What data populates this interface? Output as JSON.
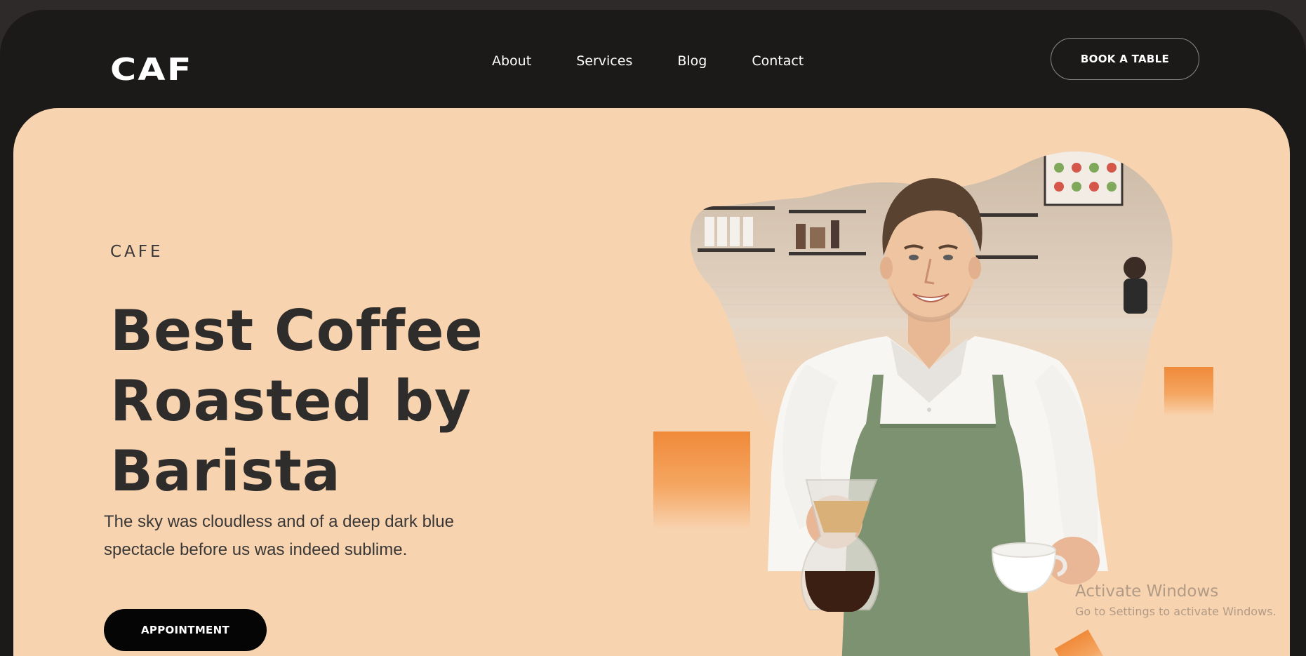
{
  "header": {
    "logo": "CAF",
    "nav": [
      {
        "label": "About"
      },
      {
        "label": "Services"
      },
      {
        "label": "Blog"
      },
      {
        "label": "Contact"
      }
    ],
    "cta_label": "BOOK A TABLE"
  },
  "hero": {
    "eyebrow": "CAFE",
    "headline_lines": [
      "Best Coffee",
      "Roasted by",
      "Barista"
    ],
    "description_lines": [
      "The sky was cloudless and of a deep dark blue",
      "spectacle before us was indeed sublime."
    ],
    "button_label": "APPOINTMENT"
  },
  "overlay": {
    "watermark_title": "Activate Windows",
    "watermark_sub": "Go to Settings to activate Windows."
  },
  "colors": {
    "page_bg": "#1b1a19",
    "hero_bg": "#f8d3b0",
    "accent": "#f08a3a",
    "text_dark": "#2f2d2c"
  },
  "icons": [
    "barista-photo"
  ]
}
